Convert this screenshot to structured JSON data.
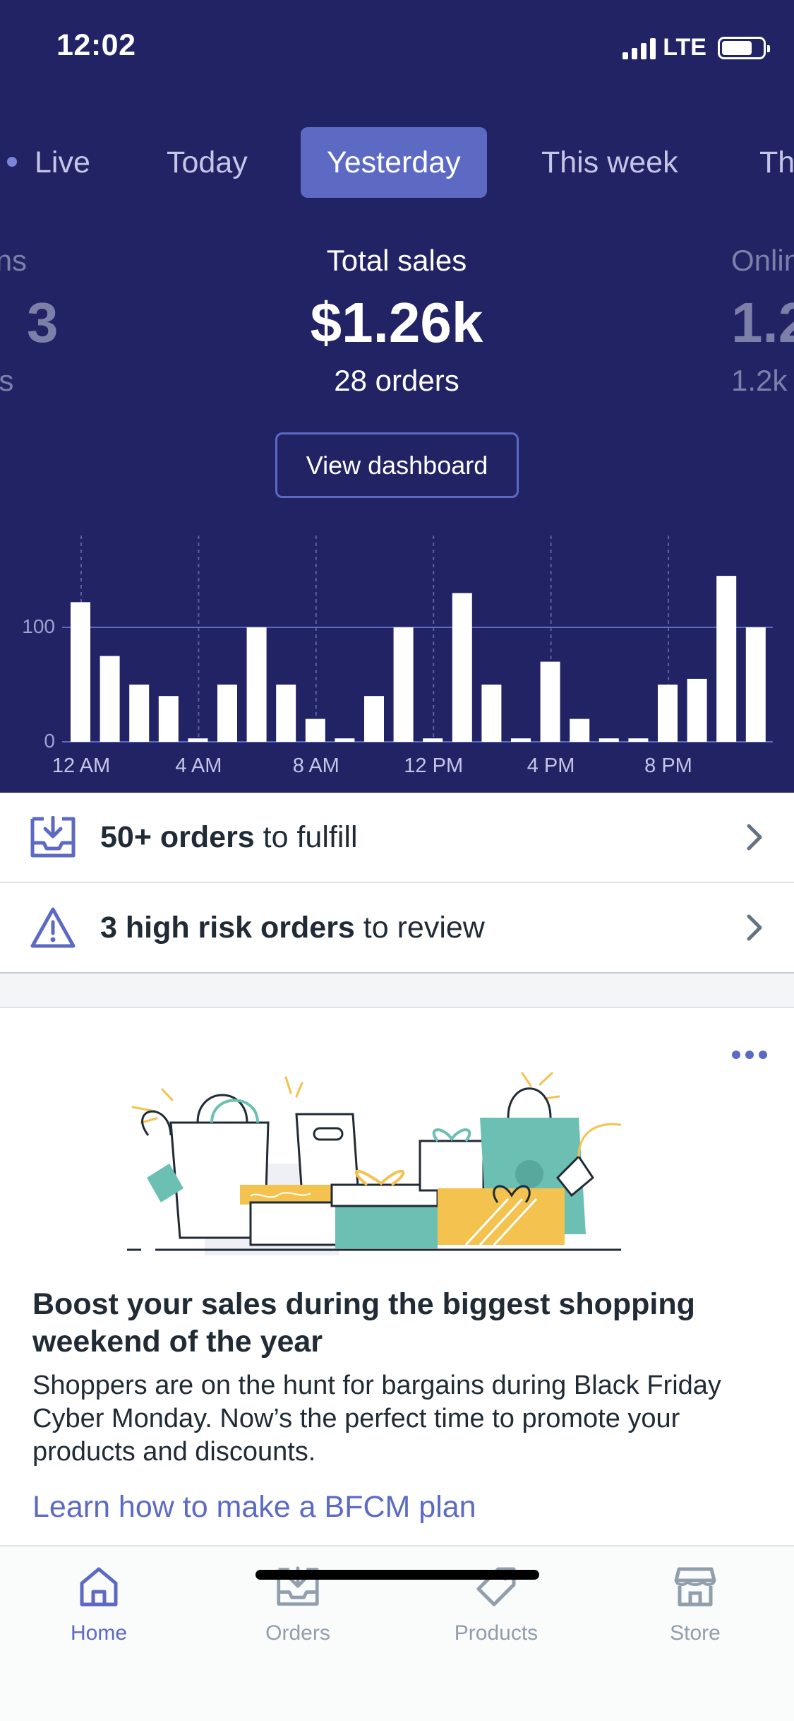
{
  "status_bar": {
    "time": "12:02",
    "network": "LTE"
  },
  "tabs": [
    {
      "label": "Live"
    },
    {
      "label": "Today"
    },
    {
      "label": "Yesterday",
      "active": true
    },
    {
      "label": "This week"
    },
    {
      "label": "Th"
    }
  ],
  "metrics": {
    "left": {
      "label": "sions",
      "value": "3",
      "sub": "itors"
    },
    "center": {
      "label": "Total sales",
      "value": "$1.26k",
      "sub": "28 orders"
    },
    "right": {
      "label": "Onlin",
      "value": "1.2",
      "sub": "1.2k"
    }
  },
  "view_dashboard_label": "View dashboard",
  "chart_data": {
    "type": "bar",
    "y_ticks": [
      "100",
      "0"
    ],
    "x_ticks": [
      "12 AM",
      "4 AM",
      "8 AM",
      "12 PM",
      "4 PM",
      "8 PM"
    ],
    "ylim": [
      0,
      180
    ],
    "values": [
      122,
      75,
      50,
      40,
      3,
      50,
      100,
      50,
      20,
      3,
      40,
      100,
      3,
      130,
      50,
      3,
      70,
      20,
      3,
      3,
      50,
      55,
      145,
      100
    ],
    "grid": true
  },
  "tasks": [
    {
      "bold": "50+ orders",
      "rest": " to fulfill",
      "icon": "inbox-download-icon"
    },
    {
      "bold": "3 high risk orders",
      "rest": " to review",
      "icon": "warning-triangle-icon"
    }
  ],
  "card": {
    "title": "Boost your sales during the biggest shopping weekend of the year",
    "body": "Shoppers are on the hunt for bargains during Black Friday Cyber Monday. Now’s the perfect time to promote your products and discounts.",
    "link": "Learn how to make a BFCM plan"
  },
  "bottom_nav": [
    {
      "label": "Home",
      "icon": "home-icon",
      "active": true
    },
    {
      "label": "Orders",
      "icon": "orders-icon"
    },
    {
      "label": "Products",
      "icon": "tag-icon"
    },
    {
      "label": "Store",
      "icon": "store-icon"
    }
  ],
  "colors": {
    "hero_bg": "#212365",
    "accent": "#5c6ac4",
    "text": "#212b36"
  }
}
